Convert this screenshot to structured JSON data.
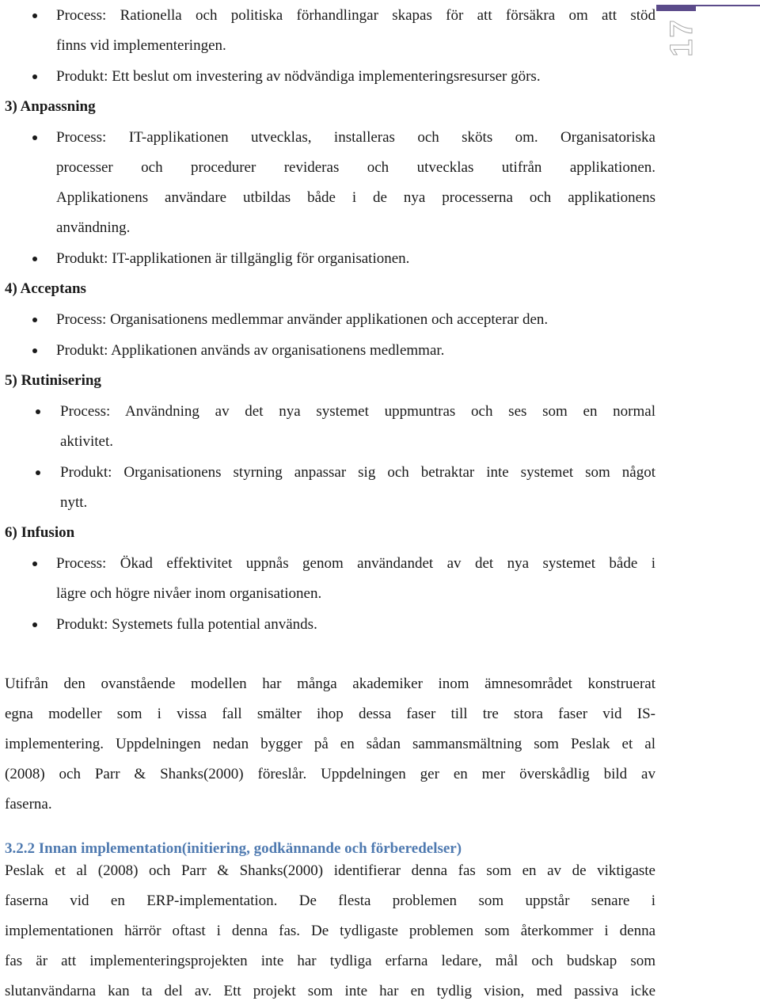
{
  "page_number": "17",
  "colors": {
    "accent": "#5b4b8a",
    "subheading": "#4f7ab0",
    "text": "#1a1a1a"
  },
  "sections": [
    {
      "heading": null,
      "items": [
        {
          "lines": [
            "Process: Rationella och politiska förhandlingar skapas för att försäkra om att stöd",
            "finns vid implementeringen."
          ]
        },
        {
          "lines": [
            "Produkt: Ett beslut om investering av nödvändiga implementeringsresurser görs."
          ]
        }
      ]
    },
    {
      "heading": "3) Anpassning",
      "items": [
        {
          "lines": [
            "Process: IT-applikationen utvecklas, installeras och sköts om. Organisatoriska",
            "processer och procedurer revideras och utvecklas utifrån applikationen.",
            "Applikationens användare utbildas både i de nya processerna och applikationens",
            "användning."
          ]
        },
        {
          "lines": [
            "Produkt: IT-applikationen är tillgänglig för organisationen."
          ]
        }
      ]
    },
    {
      "heading": "4) Acceptans",
      "items": [
        {
          "lines": [
            "Process: Organisationens medlemmar använder applikationen och accepterar den."
          ]
        },
        {
          "lines": [
            "Produkt: Applikationen används av organisationens medlemmar."
          ]
        }
      ]
    },
    {
      "heading": "5) Rutinisering",
      "items": [
        {
          "lines": [
            "Process: Användning av det nya systemet uppmuntras och ses som en normal",
            "aktivitet."
          ]
        },
        {
          "lines": [
            "Produkt: Organisationens styrning anpassar sig och betraktar inte systemet som något",
            "nytt."
          ]
        }
      ]
    },
    {
      "heading": "6) Infusion",
      "items": [
        {
          "lines": [
            "Process: Ökad effektivitet uppnås genom användandet av det nya systemet både i",
            "lägre och högre nivåer inom organisationen."
          ]
        },
        {
          "lines": [
            "Produkt: Systemets fulla potential används."
          ]
        }
      ]
    }
  ],
  "paragraph1": [
    "Utifrån den ovanstående modellen har många akademiker inom ämnesområdet konstruerat",
    "egna modeller som i vissa fall smälter ihop dessa faser till tre stora faser vid IS-",
    "implementering. Uppdelningen nedan bygger på en sådan sammansmältning som Peslak et al",
    "(2008) och Parr & Shanks(2000) föreslår. Uppdelningen ger en mer överskådlig bild av",
    "faserna."
  ],
  "subheading": "3.2.2 Innan implementation(initiering, godkännande och förberedelser)",
  "paragraph2": [
    "Peslak et al (2008) och Parr & Shanks(2000) identifierar denna fas som en av de viktigaste",
    "faserna vid en ERP-implementation. De flesta problemen som uppstår senare i",
    "implementationen härrör oftast i denna fas. De tydligaste problemen som återkommer i denna",
    "fas är att implementeringsprojekten inte har tydliga erfarna ledare, mål och budskap som",
    "slutanvändarna kan ta del av. Ett projekt som inte har en tydlig vision, med passiva icke"
  ]
}
